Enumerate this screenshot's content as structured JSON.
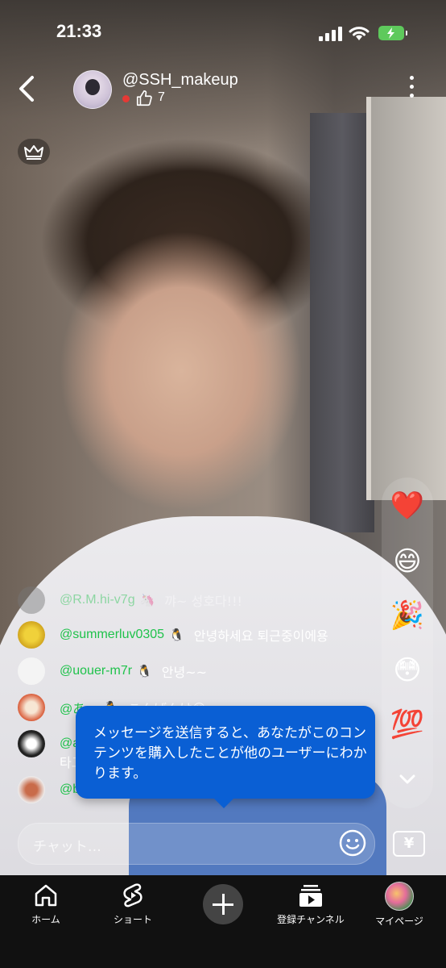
{
  "status_bar": {
    "time": "21:33"
  },
  "header": {
    "handle": "@SSH_makeup",
    "likes": "7",
    "icons": [
      "back-chevron-icon",
      "thumbs-up-icon",
      "more-vertical-icon",
      "crown-icon"
    ]
  },
  "chat": [
    {
      "user": "@R.M.hi-v7g",
      "badge": "🦄",
      "message": "꺄~ 성호다!!!"
    },
    {
      "user": "@summerluv0305",
      "badge": "🐧",
      "message": "안녕하세요 퇴근중이에용"
    },
    {
      "user": "@uouer-m7r",
      "badge": "🐧",
      "message": "안녕~~"
    },
    {
      "user": "@あ…",
      "badge": "🐧",
      "message": "こんばんは😊"
    },
    {
      "user": "@a…",
      "badge": "",
      "message": "타고…"
    },
    {
      "user": "@b…",
      "badge": "",
      "message": ""
    }
  ],
  "reactions": [
    "❤️",
    "😄",
    "🎉",
    "😳",
    "💯"
  ],
  "tooltip": {
    "text": "メッセージを送信すると、あなたがこのコンテンツを購入したことが他のユーザーにわかります。"
  },
  "input": {
    "placeholder": "チャット…",
    "currency": "¥"
  },
  "nav": [
    {
      "label": "ホーム",
      "icon": "home-icon"
    },
    {
      "label": "ショート",
      "icon": "shorts-icon"
    },
    {
      "label": "",
      "icon": "plus-icon"
    },
    {
      "label": "登録チャンネル",
      "icon": "subscriptions-icon"
    },
    {
      "label": "マイページ",
      "icon": "avatar-icon"
    }
  ],
  "colors": {
    "username": "#1fc24b",
    "tooltip": "#0a5fd4",
    "live": "#e53935",
    "battery": "#5ec95c"
  }
}
